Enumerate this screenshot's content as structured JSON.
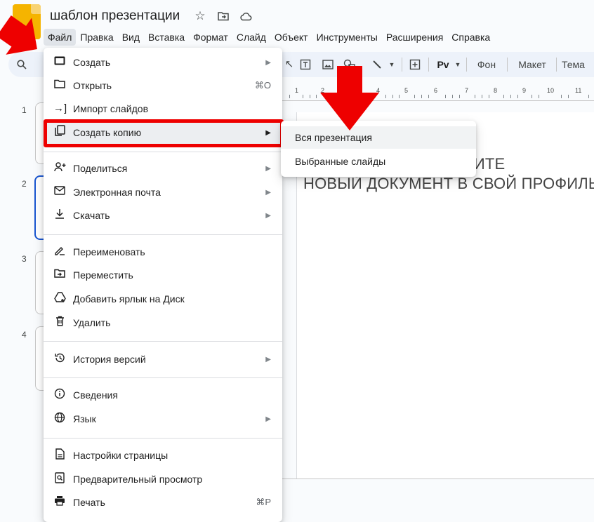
{
  "document": {
    "title": "шаблон презентации",
    "title_icons": [
      "star-icon",
      "move-folder-icon",
      "cloud-status-icon"
    ]
  },
  "menubar": [
    {
      "label": "Файл",
      "active": true
    },
    {
      "label": "Правка"
    },
    {
      "label": "Вид"
    },
    {
      "label": "Вставка"
    },
    {
      "label": "Формат"
    },
    {
      "label": "Слайд"
    },
    {
      "label": "Объект"
    },
    {
      "label": "Инструменты"
    },
    {
      "label": "Расширения"
    },
    {
      "label": "Справка"
    }
  ],
  "toolbar": {
    "search_icon": "search-icon",
    "fon_label": "Фон",
    "maket_label": "Макет",
    "tema_label": "Тема"
  },
  "ruler": {
    "ticks": [
      "1",
      "2",
      "3",
      "4",
      "5",
      "6",
      "7",
      "8",
      "9",
      "10",
      "11"
    ]
  },
  "filmstrip": {
    "slide_numbers": [
      "1",
      "2",
      "3",
      "4"
    ],
    "selected": "2"
  },
  "canvas": {
    "line1": "ДЛЯ РАБОТЫ СОХРАНИТЕ",
    "line2": "НОВЫЙ ДОКУМЕНТ В СВОЙ ПРОФИЛЬ"
  },
  "file_menu": {
    "items": [
      {
        "label": "Создать",
        "icon": "new-presentation-icon",
        "submenu": true
      },
      {
        "label": "Открыть",
        "icon": "folder-icon",
        "shortcut": "⌘O"
      },
      {
        "label": "Импорт слайдов",
        "icon": "import-icon"
      },
      {
        "label": "Создать копию",
        "icon": "copy-icon",
        "submenu": true,
        "highlighted": true
      },
      {
        "label": "Поделиться",
        "icon": "share-person-icon",
        "submenu": true
      },
      {
        "label": "Электронная почта",
        "icon": "mail-icon",
        "submenu": true
      },
      {
        "label": "Скачать",
        "icon": "download-icon",
        "submenu": true
      },
      {
        "label": "Переименовать",
        "icon": "rename-icon"
      },
      {
        "label": "Переместить",
        "icon": "move-icon"
      },
      {
        "label": "Добавить ярлык на Диск",
        "icon": "drive-shortcut-icon"
      },
      {
        "label": "Удалить",
        "icon": "trash-icon"
      },
      {
        "label": "История версий",
        "icon": "history-icon",
        "submenu": true
      },
      {
        "label": "Сведения",
        "icon": "info-icon"
      },
      {
        "label": "Язык",
        "icon": "globe-icon",
        "submenu": true
      },
      {
        "label": "Настройки страницы",
        "icon": "page-setup-icon"
      },
      {
        "label": "Предварительный просмотр",
        "icon": "preview-icon"
      },
      {
        "label": "Печать",
        "icon": "print-icon",
        "shortcut": "⌘P"
      }
    ]
  },
  "copy_submenu": {
    "items": [
      {
        "label": "Вся презентация",
        "highlighted": true
      },
      {
        "label": "Выбранные слайды"
      }
    ]
  },
  "colors": {
    "accent_red": "#ee0000",
    "selection_blue": "#1a56d0",
    "logo_yellow": "#f5b400"
  }
}
